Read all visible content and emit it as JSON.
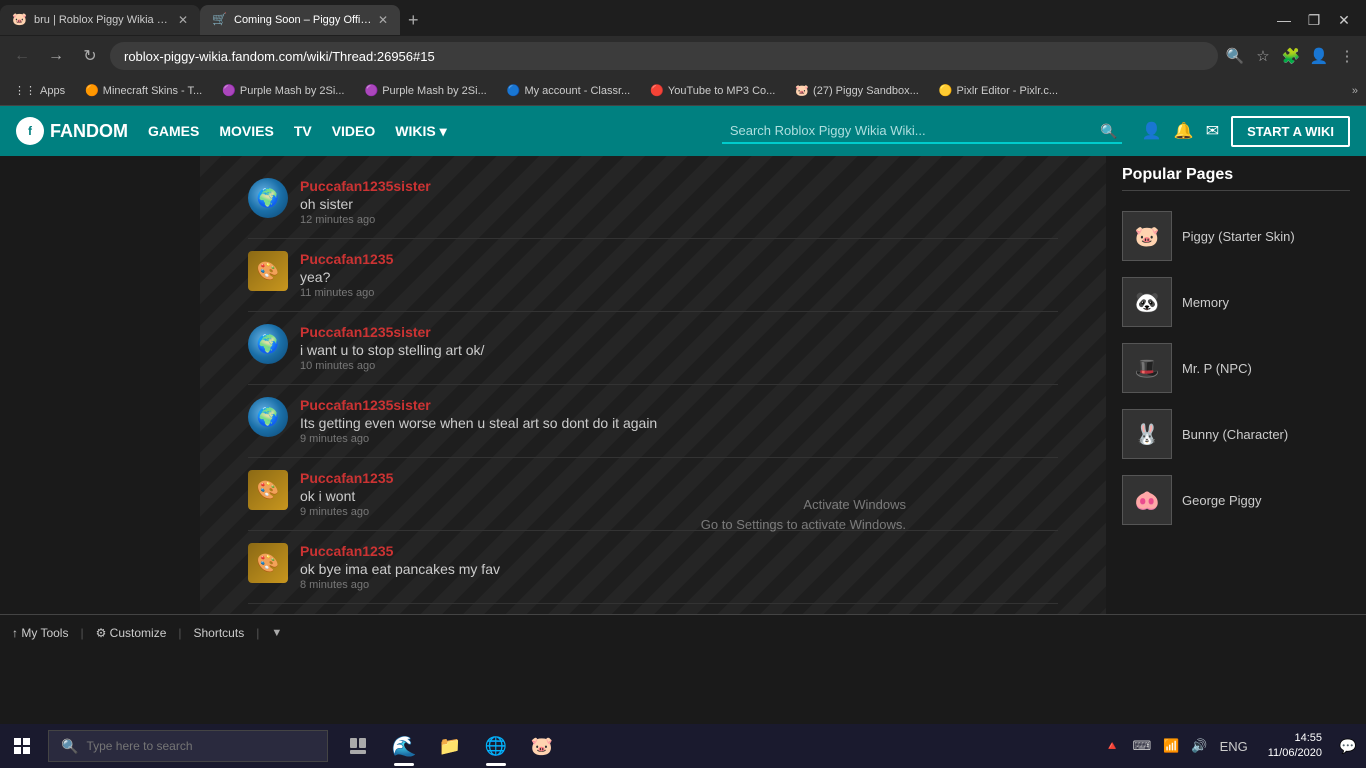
{
  "browser": {
    "tabs": [
      {
        "id": "tab1",
        "favicon": "🐷",
        "title": "bru | Roblox Piggy Wikia Wiki | F...",
        "active": false
      },
      {
        "id": "tab2",
        "favicon": "🛒",
        "title": "Coming Soon – Piggy Official Sto...",
        "active": true
      }
    ],
    "address": "roblox-piggy-wikia.fandom.com/wiki/Thread:26956#15",
    "window_controls": {
      "minimize": "—",
      "maximize": "❐",
      "close": "✕"
    }
  },
  "bookmarks": [
    {
      "id": "apps",
      "favicon": "⋮⋮",
      "label": "Apps"
    },
    {
      "id": "bm2",
      "favicon": "🟠",
      "label": "Minecraft Skins - T..."
    },
    {
      "id": "bm3",
      "favicon": "🟣",
      "label": "Purple Mash by 2Si..."
    },
    {
      "id": "bm4",
      "favicon": "🟣",
      "label": "Purple Mash by 2Si..."
    },
    {
      "id": "bm5",
      "favicon": "🔵",
      "label": "My account - Classr..."
    },
    {
      "id": "bm6",
      "favicon": "🔴",
      "label": "YouTube to MP3 Co..."
    },
    {
      "id": "bm7",
      "favicon": "🐷",
      "label": "(27) Piggy Sandbox..."
    },
    {
      "id": "bm8",
      "favicon": "🟡",
      "label": "Pixlr Editor - Pixlr.c..."
    }
  ],
  "fandom_header": {
    "logo": "FANDOM",
    "nav_items": [
      "GAMES",
      "MOVIES",
      "TV",
      "VIDEO",
      "WIKIS ▾"
    ],
    "search_placeholder": "Search Roblox Piggy Wikia Wiki...",
    "start_wiki_label": "START A WIKI"
  },
  "chat_messages": [
    {
      "id": "msg1",
      "avatar_type": "globe",
      "username": "Puccafan1235sister",
      "text": "oh sister",
      "time": "12 minutes ago"
    },
    {
      "id": "msg2",
      "avatar_type": "puccafan",
      "username": "Puccafan1235",
      "text": "yea?",
      "time": "11 minutes ago"
    },
    {
      "id": "msg3",
      "avatar_type": "globe",
      "username": "Puccafan1235sister",
      "text": "i want u to stop stelling art ok/",
      "time": "10 minutes ago"
    },
    {
      "id": "msg4",
      "avatar_type": "globe",
      "username": "Puccafan1235sister",
      "text": "Its getting even worse when u steal art so dont do it again",
      "time": "9 minutes ago"
    },
    {
      "id": "msg5",
      "avatar_type": "puccafan",
      "username": "Puccafan1235",
      "text": "ok i wont",
      "time": "9 minutes ago"
    },
    {
      "id": "msg6",
      "avatar_type": "puccafan",
      "username": "Puccafan1235",
      "text": "ok bye ima eat pancakes my fav",
      "time": "8 minutes ago"
    }
  ],
  "popular_pages": {
    "title": "Popular Pages",
    "items": [
      {
        "id": "pp1",
        "name": "Piggy (Starter Skin)",
        "emoji": "🐷"
      },
      {
        "id": "pp2",
        "name": "Memory",
        "emoji": "🐼"
      },
      {
        "id": "pp3",
        "name": "Mr. P (NPC)",
        "emoji": "🎩"
      },
      {
        "id": "pp4",
        "name": "Bunny (Character)",
        "emoji": "🐰"
      },
      {
        "id": "pp5",
        "name": "George Piggy",
        "emoji": "🐽"
      }
    ]
  },
  "toolbar": {
    "my_tools": "↑  My Tools",
    "customize": "⚙ Customize",
    "shortcuts": "Shortcuts"
  },
  "activate_windows": {
    "line1": "Activate Windows",
    "line2": "Go to Settings to activate Windows."
  },
  "taskbar": {
    "search_placeholder": "Type here to search",
    "time": "14:55",
    "date": "11/06/2020",
    "language": "ENG"
  }
}
